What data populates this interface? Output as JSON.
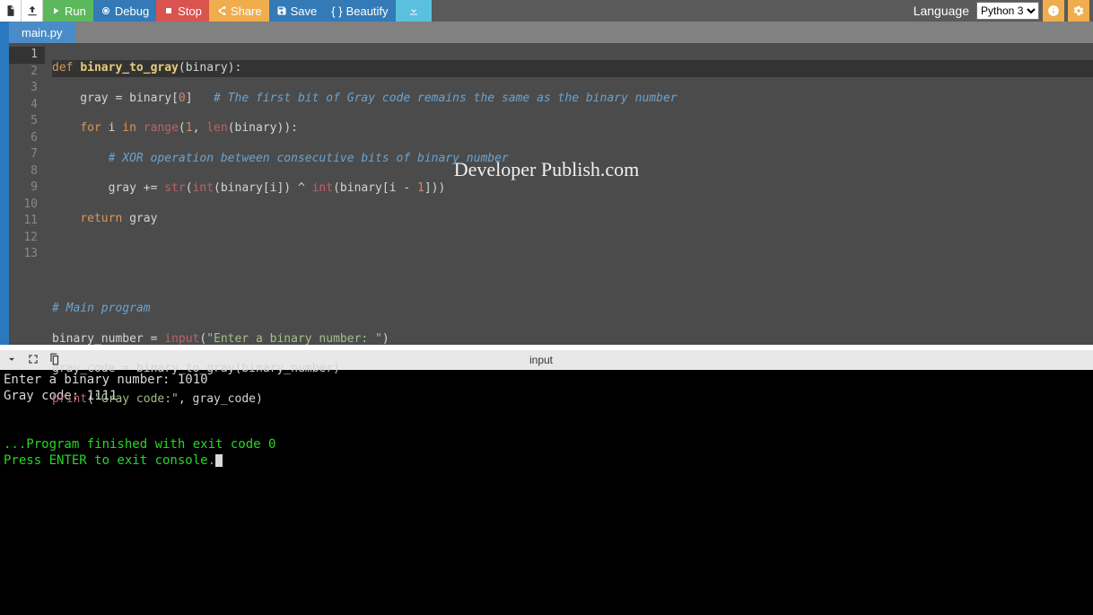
{
  "toolbar": {
    "run": "Run",
    "debug": "Debug",
    "stop": "Stop",
    "share": "Share",
    "save": "Save",
    "beautify": "Beautify",
    "language_label": "Language",
    "language_value": "Python 3"
  },
  "tabs": {
    "active": "main.py"
  },
  "code": {
    "lines": [
      "def binary_to_gray(binary):",
      "    gray = binary[0]   # The first bit of Gray code remains the same as the binary number",
      "    for i in range(1, len(binary)):",
      "        # XOR operation between consecutive bits of binary number",
      "        gray += str(int(binary[i]) ^ int(binary[i - 1]))",
      "    return gray",
      "",
      "",
      "# Main program",
      "binary_number = input(\"Enter a binary number: \")",
      "gray_code = binary_to_gray(binary_number)",
      "print(\"Gray code:\", gray_code)",
      ""
    ]
  },
  "watermark": "Developer Publish.com",
  "console": {
    "title": "input",
    "out1": "Enter a binary number: 1010",
    "out2": "Gray code: 1111",
    "exit": "...Program finished with exit code 0",
    "press": "Press ENTER to exit console."
  }
}
